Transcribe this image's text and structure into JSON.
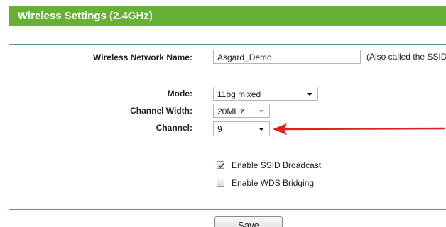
{
  "section": {
    "title": "Wireless Settings (2.4GHz)"
  },
  "form": {
    "network_name_label": "Wireless Network Name:",
    "network_name_value": "Asgard_Demo",
    "network_name_hint": "(Also called the SSID)",
    "mode_label": "Mode:",
    "mode_value": "11bg mixed",
    "channel_width_label": "Channel Width:",
    "channel_width_value": "20MHz",
    "channel_label": "Channel:",
    "channel_value": "9",
    "ssid_broadcast_label": "Enable SSID Broadcast",
    "ssid_broadcast_checked": true,
    "wds_bridging_label": "Enable WDS Bridging",
    "wds_bridging_checked": false,
    "save_label": "Save"
  },
  "annotation": {
    "arrow_color": "#e02020",
    "arrow_icon": "red-pointer-arrow"
  },
  "colors": {
    "header_bg": "#66b035",
    "divider": "#5a9a8a"
  }
}
